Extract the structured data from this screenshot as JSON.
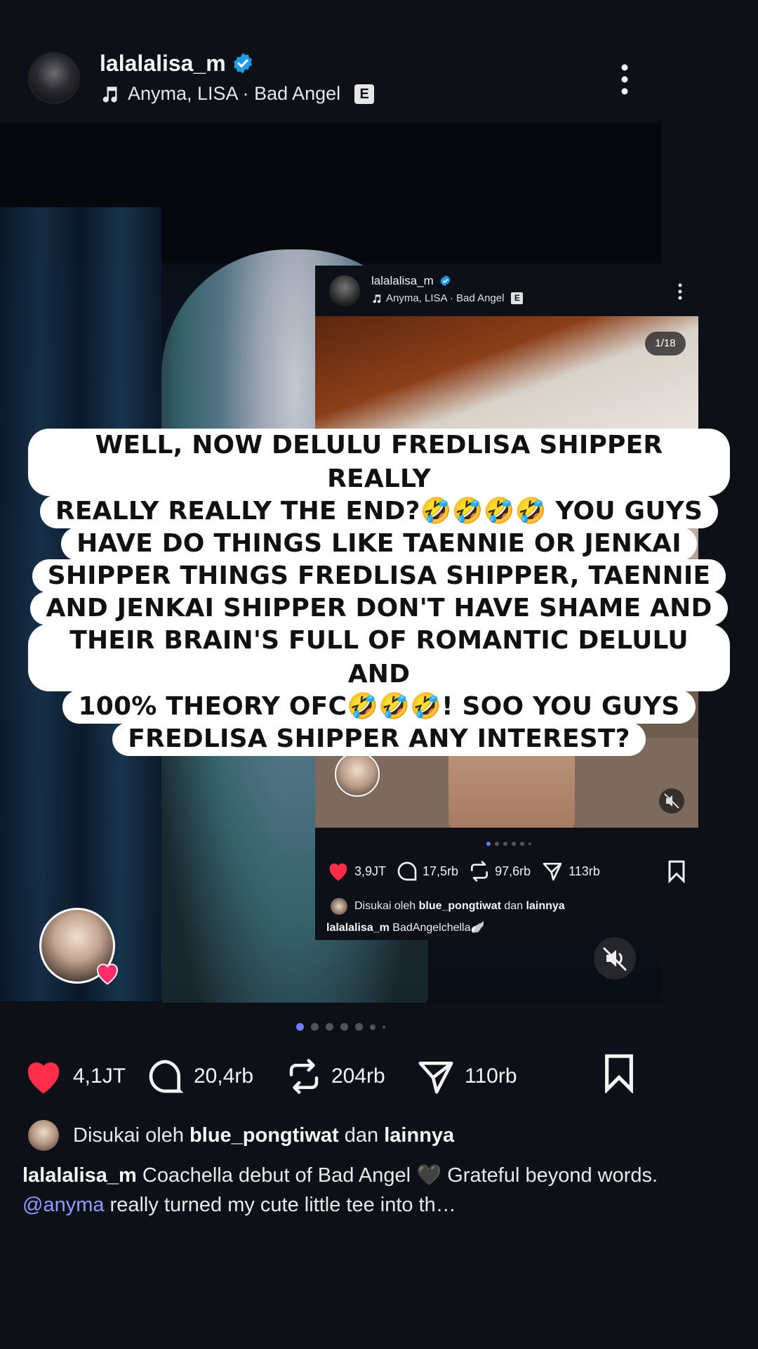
{
  "header": {
    "username": "lalalalisa_m",
    "music": "Anyma, LISA · Bad Angel",
    "explicit_badge": "E",
    "more_icon": "more-vertical-icon"
  },
  "embedded_post": {
    "username": "lalalalisa_m",
    "music": "Anyma, LISA · Bad Angel",
    "explicit_badge": "E",
    "counter": "1/18",
    "likes": "3,9JT",
    "comments": "17,5rb",
    "reposts": "97,6rb",
    "shares": "113rb",
    "liked_by_prefix": "Disukai oleh",
    "liked_by_user": "blue_pongtiwat",
    "liked_by_join": "dan",
    "liked_by_others": "lainnya",
    "caption_user": "lalalalisa_m",
    "caption_text": "BadAngelchella🪽"
  },
  "overlay_lines": [
    "WELL, NOW DELULU FREDLISA SHIPPER REALLY",
    "REALLY REALLY THE END?🤣🤣🤣🤣 YOU GUYS",
    "HAVE DO THINGS LIKE TAENNIE OR JENKAI",
    "SHIPPER THINGS FREDLISA SHIPPER, TAENNIE",
    "AND JENKAI SHIPPER DON'T HAVE  SHAME AND",
    "THEIR BRAIN'S FULL OF ROMANTIC DELULU AND",
    "100% THEORY OFC🤣🤣🤣! SOO YOU GUYS",
    "FREDLISA SHIPPER  ANY INTEREST?"
  ],
  "actions": {
    "likes": "4,1JT",
    "comments": "20,4rb",
    "reposts": "204rb",
    "shares": "110rb"
  },
  "liked_by": {
    "prefix": "Disukai oleh",
    "user": "blue_pongtiwat",
    "join": "dan",
    "others": "lainnya"
  },
  "caption": {
    "user": "lalalalisa_m",
    "text1": "Coachella debut of Bad Angel 🖤 Grateful beyond words.",
    "mention": "@anyma",
    "text2": "really turned my cute little tee into th…"
  },
  "colors": {
    "background": "#0d1016",
    "like_red": "#ff2d4a",
    "verified_blue": "#1d9bf0",
    "active_dot": "#6f7dff",
    "mention": "#8f9cff"
  }
}
